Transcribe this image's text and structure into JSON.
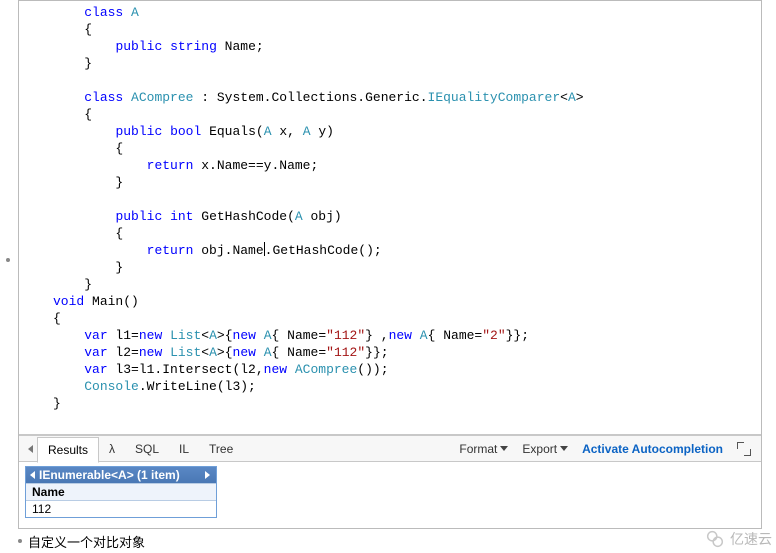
{
  "code": {
    "lines": [
      [
        {
          "t": "class",
          "c": "kw"
        },
        {
          "t": " ",
          "c": "pl"
        },
        {
          "t": "A",
          "c": "type"
        }
      ],
      [
        {
          "t": "{",
          "c": "pl"
        }
      ],
      [
        {
          "t": "    ",
          "c": "pl"
        },
        {
          "t": "public",
          "c": "kw"
        },
        {
          "t": " ",
          "c": "pl"
        },
        {
          "t": "string",
          "c": "kw"
        },
        {
          "t": " Name;",
          "c": "pl"
        }
      ],
      [
        {
          "t": "}",
          "c": "pl"
        }
      ],
      [],
      [
        {
          "t": "class",
          "c": "kw"
        },
        {
          "t": " ",
          "c": "pl"
        },
        {
          "t": "ACompree",
          "c": "type"
        },
        {
          "t": " : System.Collections.Generic.",
          "c": "pl"
        },
        {
          "t": "IEqualityComparer",
          "c": "type"
        },
        {
          "t": "<",
          "c": "pl"
        },
        {
          "t": "A",
          "c": "type"
        },
        {
          "t": ">",
          "c": "pl"
        }
      ],
      [
        {
          "t": "{",
          "c": "pl"
        }
      ],
      [
        {
          "t": "    ",
          "c": "pl"
        },
        {
          "t": "public",
          "c": "kw"
        },
        {
          "t": " ",
          "c": "pl"
        },
        {
          "t": "bool",
          "c": "kw"
        },
        {
          "t": " Equals(",
          "c": "pl"
        },
        {
          "t": "A",
          "c": "type"
        },
        {
          "t": " x, ",
          "c": "pl"
        },
        {
          "t": "A",
          "c": "type"
        },
        {
          "t": " y)",
          "c": "pl"
        }
      ],
      [
        {
          "t": "    {",
          "c": "pl"
        }
      ],
      [
        {
          "t": "        ",
          "c": "pl"
        },
        {
          "t": "return",
          "c": "kw"
        },
        {
          "t": " x.Name==y.Name;",
          "c": "pl"
        }
      ],
      [
        {
          "t": "    }",
          "c": "pl"
        }
      ],
      [],
      [
        {
          "t": "    ",
          "c": "pl"
        },
        {
          "t": "public",
          "c": "kw"
        },
        {
          "t": " ",
          "c": "pl"
        },
        {
          "t": "int",
          "c": "kw"
        },
        {
          "t": " GetHashCode(",
          "c": "pl"
        },
        {
          "t": "A",
          "c": "type"
        },
        {
          "t": " obj)",
          "c": "pl"
        }
      ],
      [
        {
          "t": "    {",
          "c": "pl"
        }
      ],
      [
        {
          "t": "        ",
          "c": "pl"
        },
        {
          "t": "return",
          "c": "kw"
        },
        {
          "t": " obj.Name",
          "c": "pl"
        },
        {
          "t": "",
          "c": "cursor"
        },
        {
          "t": ".GetHashCode();",
          "c": "pl"
        }
      ],
      [
        {
          "t": "    }",
          "c": "pl"
        }
      ],
      [
        {
          "t": "}",
          "c": "pl"
        }
      ]
    ],
    "main_lines": [
      [
        {
          "t": "void",
          "c": "kw"
        },
        {
          "t": " Main()",
          "c": "pl"
        }
      ],
      [
        {
          "t": "{",
          "c": "pl"
        }
      ],
      [
        {
          "t": "    ",
          "c": "pl"
        },
        {
          "t": "var",
          "c": "kw"
        },
        {
          "t": " l1=",
          "c": "pl"
        },
        {
          "t": "new",
          "c": "kw"
        },
        {
          "t": " ",
          "c": "pl"
        },
        {
          "t": "List",
          "c": "type"
        },
        {
          "t": "<",
          "c": "pl"
        },
        {
          "t": "A",
          "c": "type"
        },
        {
          "t": ">{",
          "c": "pl"
        },
        {
          "t": "new",
          "c": "kw"
        },
        {
          "t": " ",
          "c": "pl"
        },
        {
          "t": "A",
          "c": "type"
        },
        {
          "t": "{ Name=",
          "c": "pl"
        },
        {
          "t": "\"112\"",
          "c": "str"
        },
        {
          "t": "} ,",
          "c": "pl"
        },
        {
          "t": "new",
          "c": "kw"
        },
        {
          "t": " ",
          "c": "pl"
        },
        {
          "t": "A",
          "c": "type"
        },
        {
          "t": "{ Name=",
          "c": "pl"
        },
        {
          "t": "\"2\"",
          "c": "str"
        },
        {
          "t": "}};",
          "c": "pl"
        }
      ],
      [
        {
          "t": "    ",
          "c": "pl"
        },
        {
          "t": "var",
          "c": "kw"
        },
        {
          "t": " l2=",
          "c": "pl"
        },
        {
          "t": "new",
          "c": "kw"
        },
        {
          "t": " ",
          "c": "pl"
        },
        {
          "t": "List",
          "c": "type"
        },
        {
          "t": "<",
          "c": "pl"
        },
        {
          "t": "A",
          "c": "type"
        },
        {
          "t": ">{",
          "c": "pl"
        },
        {
          "t": "new",
          "c": "kw"
        },
        {
          "t": " ",
          "c": "pl"
        },
        {
          "t": "A",
          "c": "type"
        },
        {
          "t": "{ Name=",
          "c": "pl"
        },
        {
          "t": "\"112\"",
          "c": "str"
        },
        {
          "t": "}};",
          "c": "pl"
        }
      ],
      [
        {
          "t": "    ",
          "c": "pl"
        },
        {
          "t": "var",
          "c": "kw"
        },
        {
          "t": " l3=l1.Intersect(l2,",
          "c": "pl"
        },
        {
          "t": "new",
          "c": "kw"
        },
        {
          "t": " ",
          "c": "pl"
        },
        {
          "t": "ACompree",
          "c": "type"
        },
        {
          "t": "());",
          "c": "pl"
        }
      ],
      [
        {
          "t": "    ",
          "c": "pl"
        },
        {
          "t": "Console",
          "c": "type"
        },
        {
          "t": ".WriteLine(l3);",
          "c": "pl"
        }
      ],
      [
        {
          "t": "}",
          "c": "pl"
        }
      ]
    ]
  },
  "tabs": {
    "results": "Results",
    "lambda": "λ",
    "sql": "SQL",
    "il": "IL",
    "tree": "Tree"
  },
  "toolbar": {
    "format": "Format",
    "export": "Export",
    "activate": "Activate Autocompletion"
  },
  "result": {
    "header": "IEnumerable<A> (1 item)",
    "colhead": "Name",
    "value": "112"
  },
  "caption": "自定义一个对比对象",
  "watermark": "亿速云"
}
